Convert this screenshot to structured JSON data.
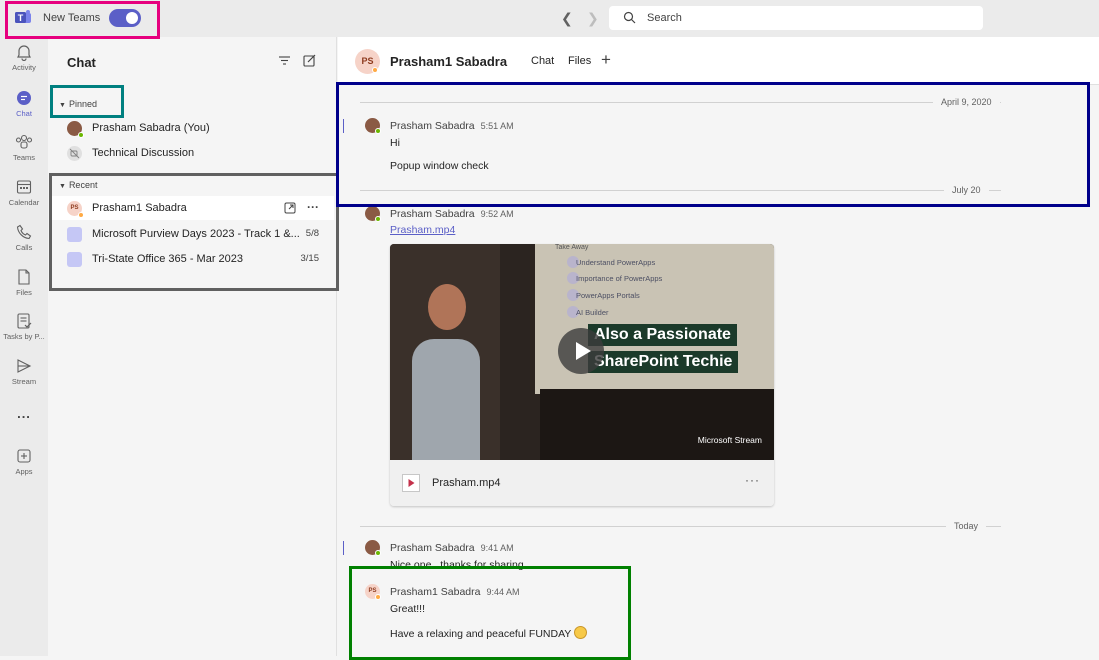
{
  "topbar": {
    "product_label": "New Teams",
    "toggle_on": true,
    "search_placeholder": "Search"
  },
  "rail": [
    {
      "label": "Activity",
      "icon": "bell-icon"
    },
    {
      "label": "Chat",
      "icon": "chat-icon",
      "active": true
    },
    {
      "label": "Teams",
      "icon": "teams-icon"
    },
    {
      "label": "Calendar",
      "icon": "calendar-icon"
    },
    {
      "label": "Calls",
      "icon": "phone-icon"
    },
    {
      "label": "Files",
      "icon": "file-icon"
    },
    {
      "label": "Tasks by P...",
      "icon": "tasks-icon"
    },
    {
      "label": "Stream",
      "icon": "stream-icon"
    },
    {
      "label": "...",
      "icon": "more-icon"
    },
    {
      "label": "Apps",
      "icon": "apps-icon"
    }
  ],
  "chatlist": {
    "title": "Chat",
    "pinned_label": "Pinned",
    "recent_label": "Recent",
    "pinned": [
      {
        "name": "Prasham Sabadra (You)",
        "presence": "available"
      },
      {
        "name": "Technical Discussion"
      }
    ],
    "recent": [
      {
        "name": "Prasham1 Sabadra",
        "initials": "PS",
        "date": ""
      },
      {
        "name": "Microsoft Purview Days 2023 - Track 1 &...",
        "date": "5/8"
      },
      {
        "name": "Tri-State Office 365 - Mar 2023",
        "date": "3/15"
      }
    ]
  },
  "conversation": {
    "initials": "PS",
    "name": "Prasham1 Sabadra",
    "tabs": [
      "Chat",
      "Files"
    ],
    "date_1": "April 9, 2020",
    "date_2": "July 20",
    "date_3": "Today",
    "messages": [
      {
        "author": "Prasham Sabadra",
        "time": "5:51 AM",
        "lines": [
          "Hi",
          "Popup window check"
        ]
      },
      {
        "author": "Prasham Sabadra",
        "time": "9:52 AM",
        "link": "Prasham.mp4"
      },
      {
        "author": "Prasham Sabadra",
        "time": "9:41 AM",
        "lines": [
          "Nice one.. thanks for sharing"
        ]
      },
      {
        "author": "Prasham1 Sabadra",
        "time": "9:44 AM",
        "lines": [
          "Great!!!",
          "Have a relaxing and peaceful FUNDAY"
        ]
      }
    ],
    "video": {
      "slide_title": "Take Away",
      "slide_items": [
        "Understand PowerApps",
        "Importance of PowerApps",
        "PowerApps Portals",
        "AI Builder"
      ],
      "banner_1": "Also a Passionate",
      "banner_2": "SharePoint Techie",
      "brand": "Microsoft Stream",
      "file_name": "Prasham.mp4"
    }
  },
  "colors": {
    "accent": "#5b5fc7",
    "highlight_topbar": "#e6007e",
    "highlight_pinned": "#008080",
    "highlight_recent": "#606060",
    "highlight_message": "#00008b",
    "highlight_latest": "#008000"
  }
}
